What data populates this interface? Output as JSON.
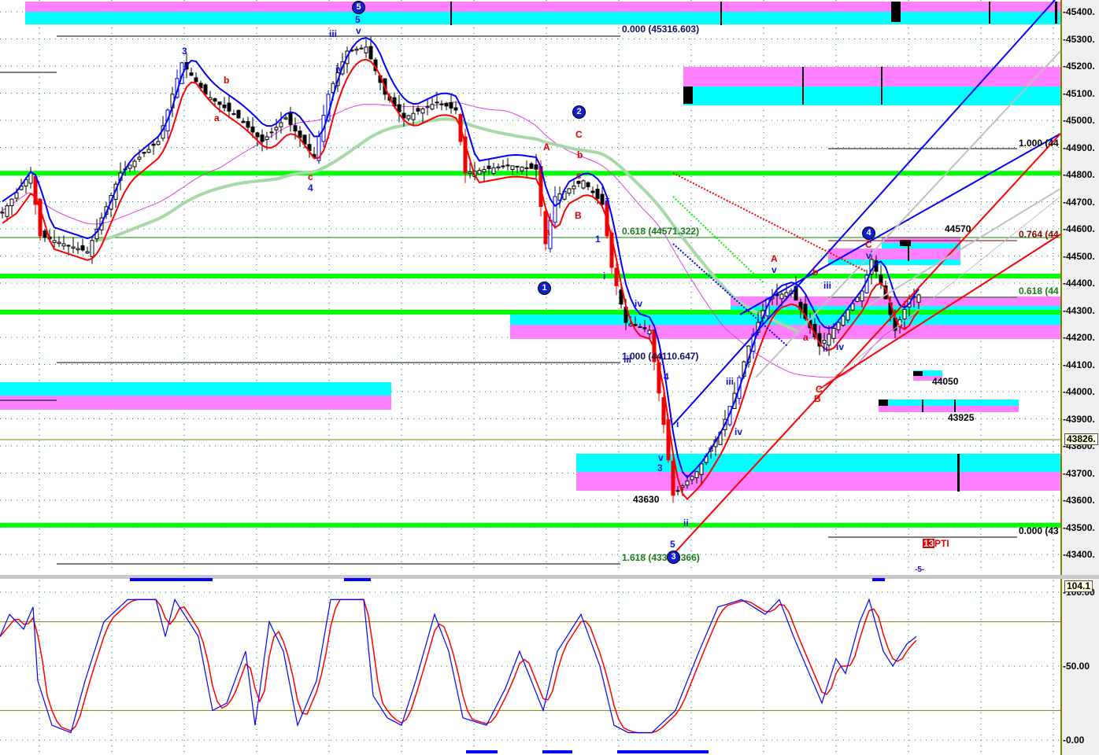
{
  "colors": {
    "cyan": "#00ffff",
    "pink": "#ff80ff",
    "green": "#00ff00",
    "blue": "#0000ff",
    "red": "#ff0000",
    "grid": "#008080"
  },
  "chart_data": [
    {
      "type": "candlestick",
      "title": "Price",
      "ylim": [
        43350,
        45450
      ],
      "yticks": [
        "45400.",
        "45300.",
        "45200.",
        "45100.",
        "45000.",
        "44900.",
        "44800.",
        "44700.",
        "44600.",
        "44500.",
        "44400.",
        "44300.",
        "44200.",
        "44100.",
        "44000.",
        "43900.",
        "43800.",
        "43700.",
        "43600.",
        "43500.",
        "43400."
      ],
      "last_price": "43826.",
      "close_path": [
        [
          0,
          44661
        ],
        [
          6,
          44806
        ],
        [
          8,
          44574
        ],
        [
          18,
          44516
        ],
        [
          25,
          44806
        ],
        [
          33,
          44922
        ],
        [
          38,
          45212
        ],
        [
          43,
          45096
        ],
        [
          50,
          45009
        ],
        [
          55,
          44922
        ],
        [
          60,
          45009
        ],
        [
          66,
          44864
        ],
        [
          69,
          45096
        ],
        [
          73,
          45255
        ],
        [
          77,
          45270
        ],
        [
          81,
          45096
        ],
        [
          85,
          45009
        ],
        [
          92,
          45067
        ],
        [
          96,
          45038
        ],
        [
          98,
          44806
        ],
        [
          107,
          44835
        ],
        [
          113,
          44820
        ],
        [
          115,
          44545
        ],
        [
          117,
          44719
        ],
        [
          123,
          44777
        ],
        [
          127,
          44690
        ],
        [
          129,
          44458
        ],
        [
          132,
          44255
        ],
        [
          137,
          44226
        ],
        [
          140,
          43879
        ],
        [
          142,
          43618
        ],
        [
          147,
          43705
        ],
        [
          152,
          43850
        ],
        [
          155,
          43994
        ],
        [
          158,
          44168
        ],
        [
          162,
          44342
        ],
        [
          167,
          44371
        ],
        [
          173,
          44168
        ],
        [
          177,
          44255
        ],
        [
          182,
          44371
        ],
        [
          184,
          44487
        ],
        [
          186,
          44400
        ],
        [
          189,
          44226
        ],
        [
          192,
          44342
        ],
        [
          194,
          44357
        ]
      ],
      "support_resistance": [
        44805,
        44426,
        44293,
        43508
      ],
      "fib_left": [
        "0.000 (45316.603)",
        "0.618 (44571.322)",
        "1.000 (44110.647)",
        "1.618 (433?3.366)"
      ],
      "fib_right": [
        "1.000 (44",
        "0.764 (44",
        "0.618 (44",
        "0.000 (43"
      ],
      "price_labels": [
        "44570",
        "44050",
        "43925",
        "43630"
      ],
      "pti": {
        "count": "13",
        "text": "PTI"
      }
    },
    {
      "type": "line",
      "title": "Stochastic",
      "ylim": [
        0,
        100
      ],
      "yticks": [
        "100.00",
        "50.00",
        "0.00"
      ],
      "last_value": "104.1",
      "series": [
        {
          "name": "%K",
          "color": "#0000ff",
          "values": [
            [
              0,
              70
            ],
            [
              2,
              85
            ],
            [
              5,
              75
            ],
            [
              7,
              90
            ],
            [
              8,
              40
            ],
            [
              11,
              10
            ],
            [
              15,
              5
            ],
            [
              18,
              40
            ],
            [
              22,
              80
            ],
            [
              27,
              95
            ],
            [
              33,
              95
            ],
            [
              35,
              70
            ],
            [
              37,
              95
            ],
            [
              42,
              70
            ],
            [
              45,
              20
            ],
            [
              48,
              25
            ],
            [
              52,
              60
            ],
            [
              54,
              10
            ],
            [
              57,
              80
            ],
            [
              60,
              60
            ],
            [
              63,
              10
            ],
            [
              67,
              40
            ],
            [
              70,
              95
            ],
            [
              77,
              95
            ],
            [
              79,
              30
            ],
            [
              82,
              15
            ],
            [
              85,
              10
            ],
            [
              88,
              40
            ],
            [
              92,
              85
            ],
            [
              95,
              60
            ],
            [
              98,
              15
            ],
            [
              103,
              10
            ],
            [
              107,
              35
            ],
            [
              110,
              60
            ],
            [
              115,
              20
            ],
            [
              118,
              60
            ],
            [
              123,
              85
            ],
            [
              127,
              50
            ],
            [
              130,
              10
            ],
            [
              133,
              5
            ],
            [
              138,
              5
            ],
            [
              143,
              20
            ],
            [
              148,
              60
            ],
            [
              152,
              90
            ],
            [
              157,
              95
            ],
            [
              162,
              85
            ],
            [
              165,
              95
            ],
            [
              168,
              70
            ],
            [
              172,
              40
            ],
            [
              174,
              25
            ],
            [
              177,
              55
            ],
            [
              179,
              45
            ],
            [
              182,
              80
            ],
            [
              184,
              95
            ],
            [
              187,
              60
            ],
            [
              189,
              50
            ],
            [
              192,
              65
            ],
            [
              194,
              70
            ]
          ]
        }
      ]
    }
  ],
  "wave_labels": {
    "w5top": "5",
    "w5v": "v",
    "iii": "iii",
    "iv": "iv",
    "n3": "3",
    "b": "b",
    "a": "a",
    "c": "c",
    "n4": "4",
    "A": "A",
    "C": "C",
    "B": "B",
    "bb": "b",
    "cc": "c",
    "aa": "a",
    "n1": "1",
    "i": "i",
    "ii": "ii",
    "iv2": "iv",
    "iii2": "iii",
    "n4b": "4",
    "n3b": "3",
    "v2": "v",
    "n5": "5",
    "ii2": "ii",
    "iii3": "iii",
    "iv3": "iv",
    "A2": "A",
    "v3": "v",
    "a2": "a",
    "b2": "b",
    "iii4": "iii",
    "ii3": "ii",
    "iv4": "iv",
    "C2": "C",
    "B2": "B",
    "C3": "C",
    "v4": "v",
    "m5": "-5-"
  },
  "circled": {
    "c5": "5",
    "c2": "2",
    "c1": "1",
    "c4": "4",
    "c3": "3"
  }
}
